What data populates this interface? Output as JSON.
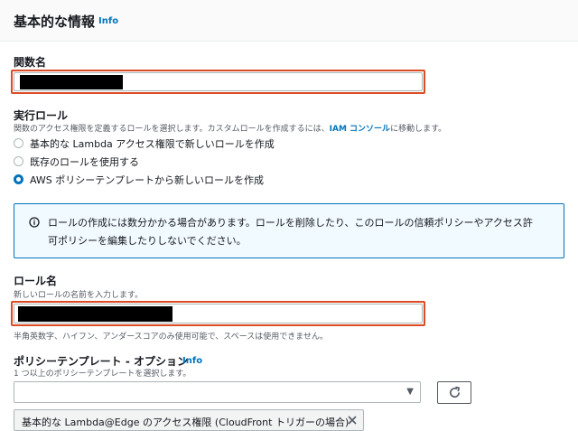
{
  "header": {
    "title": "基本的な情報",
    "info": "Info"
  },
  "function_name": {
    "label": "関数名",
    "value_redacted": true
  },
  "exec_role": {
    "label": "実行ロール",
    "description_prefix": "関数のアクセス権限を定義するロールを選択します。カスタムロールを作成するには、",
    "description_link": "IAM コンソール",
    "description_suffix": "に移動します。",
    "options": [
      {
        "label": "基本的な Lambda アクセス権限で新しいロールを作成",
        "selected": false
      },
      {
        "label": "既存のロールを使用する",
        "selected": false
      },
      {
        "label": "AWS ポリシーテンプレートから新しいロールを作成",
        "selected": true
      }
    ]
  },
  "alert": {
    "icon": "info-circle-icon",
    "line1": "ロールの作成には数分かかる場合があります。ロールを削除したり、このロールの信頼ポリシーやアクセス許",
    "line2": "可ポリシーを編集したりしないでください。"
  },
  "role_name": {
    "label": "ロール名",
    "description": "新しいロールの名前を入力します。",
    "constraint": "半角英数字、ハイフン、アンダースコアのみ使用可能で、スペースは使用できません。",
    "value_redacted": true
  },
  "policy_templates": {
    "label": "ポリシーテンプレート - オプション",
    "info": "Info",
    "description": "1 つ以上のポリシーテンプレートを選択します。",
    "select_value": "",
    "selected_tokens": [
      "基本的な Lambda@Edge のアクセス権限 (CloudFront トリガーの場合)"
    ]
  },
  "colors": {
    "accent": "#0073bb",
    "highlight": "#dd4b25",
    "alert_bg": "#f1faff"
  }
}
